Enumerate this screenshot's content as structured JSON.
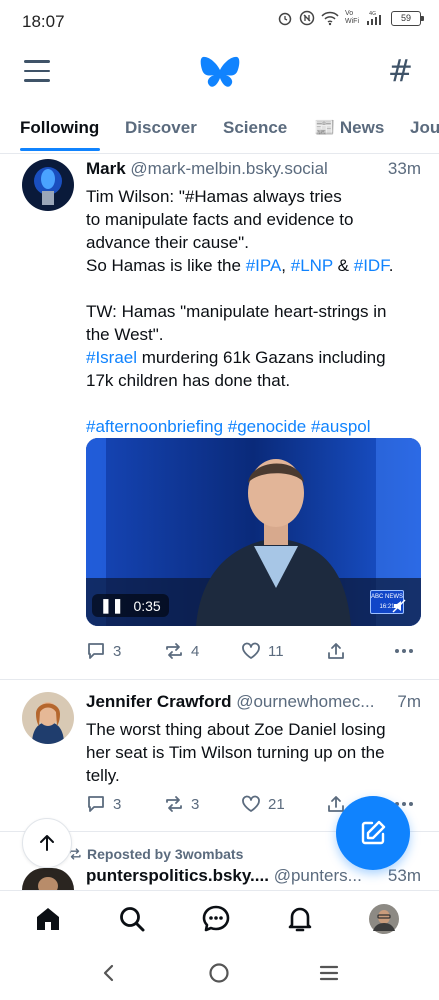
{
  "status_bar": {
    "time": "18:07",
    "signal_label": "4G",
    "volte_top": "Vo",
    "volte_bottom": "WiFi",
    "battery": "59"
  },
  "header": {
    "menu_icon": "hamburger-icon",
    "logo_icon": "butterfly-logo",
    "feeds_icon": "hash-icon"
  },
  "tabs": [
    {
      "label": "Following",
      "active": true
    },
    {
      "label": "Discover"
    },
    {
      "label": "Science"
    },
    {
      "label": "📰 News"
    },
    {
      "label": "Jou"
    }
  ],
  "posts": [
    {
      "name": "Mark",
      "handle": "@mark-melbin.bsky.social",
      "time": "33m",
      "lines": [
        "Tim Wilson: \"#Hamas always tries",
        "to manipulate facts and evidence to",
        "advance their cause\"."
      ],
      "line4_prefix": "So Hamas is like the ",
      "tag_ipa": "#IPA",
      "comma": ", ",
      "tag_lnp": "#LNP",
      "amp": " & ",
      "tag_idf": "#IDF",
      "period": ".",
      "tw_lines": [
        "TW: Hamas \"manipulate heart-strings in",
        "the West\"."
      ],
      "tag_israel": "#Israel",
      "israel_rest": " murdering 61k Gazans including",
      "last_line": "17k children has done that.",
      "hashtags": "#afternoonbriefing #genocide #auspol",
      "video": {
        "duration": "0:35",
        "badge": "ABC NEWS",
        "badge_time": "16:21"
      },
      "replies": "3",
      "reposts": "4",
      "likes": "11"
    },
    {
      "name": "Jennifer Crawford",
      "handle": "@ournewhomec...",
      "time": "7m",
      "lines": [
        "The worst thing about Zoe Daniel losing",
        "her seat is Tim Wilson turning up on the",
        "telly."
      ],
      "replies": "3",
      "reposts": "3",
      "likes": "21"
    },
    {
      "repost_label": "Reposted by 3wombats",
      "name": "punterspolitics.bsky....",
      "handle": "@punters...",
      "time": "53m"
    }
  ],
  "bottom_nav": [
    "home-icon",
    "search-icon",
    "chat-icon",
    "bell-icon",
    "profile-avatar"
  ],
  "system_nav": [
    "back-icon",
    "home-circle-icon",
    "recents-icon"
  ],
  "colors": {
    "accent": "#1083fe",
    "muted": "#5b6b7e",
    "text": "#0b0f14"
  }
}
